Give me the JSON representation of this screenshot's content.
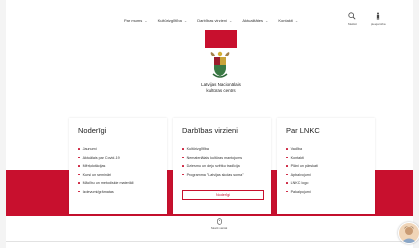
{
  "nav": {
    "items": [
      {
        "label": "Par mums",
        "has_dropdown": true
      },
      {
        "label": "Kultūrizglītība",
        "has_dropdown": true
      },
      {
        "label": "Darbības virzieni",
        "has_dropdown": true
      },
      {
        "label": "Aktualitātes",
        "has_dropdown": true
      },
      {
        "label": "Kontakti",
        "has_dropdown": true
      }
    ],
    "search_label": "Meklēt",
    "access_label": "pieejamība"
  },
  "brand": {
    "name_line1": "Latvijas Nacionālais",
    "name_line2": "kultūras centrs",
    "accent_color": "#c8102e"
  },
  "cards": [
    {
      "title": "Noderīgi",
      "items": [
        "Jaunumi",
        "Aktuālais par Covid-19",
        "Mērķdotācijas",
        "Kursi un semināri",
        "Mācību un metodiskie materiāli",
        "Izdevumi/grāmatas"
      ]
    },
    {
      "title": "Darbības virzieni",
      "items": [
        "Kultūrizglītība",
        "Nemateriālais kultūras mantojums",
        "Dziesmu un deju svētku tradīcija",
        "Programma \"Latvijas skolas soma\""
      ],
      "button_label": "Noderīgi"
    },
    {
      "title": "Par LNKC",
      "items": [
        "Vadība",
        "Kontakti",
        "Plāni un pārskati",
        "Apbalvojumi",
        "LNKC logo",
        "Pakalpojumi"
      ]
    }
  ],
  "scroll_label": "Skatīt vairāk"
}
